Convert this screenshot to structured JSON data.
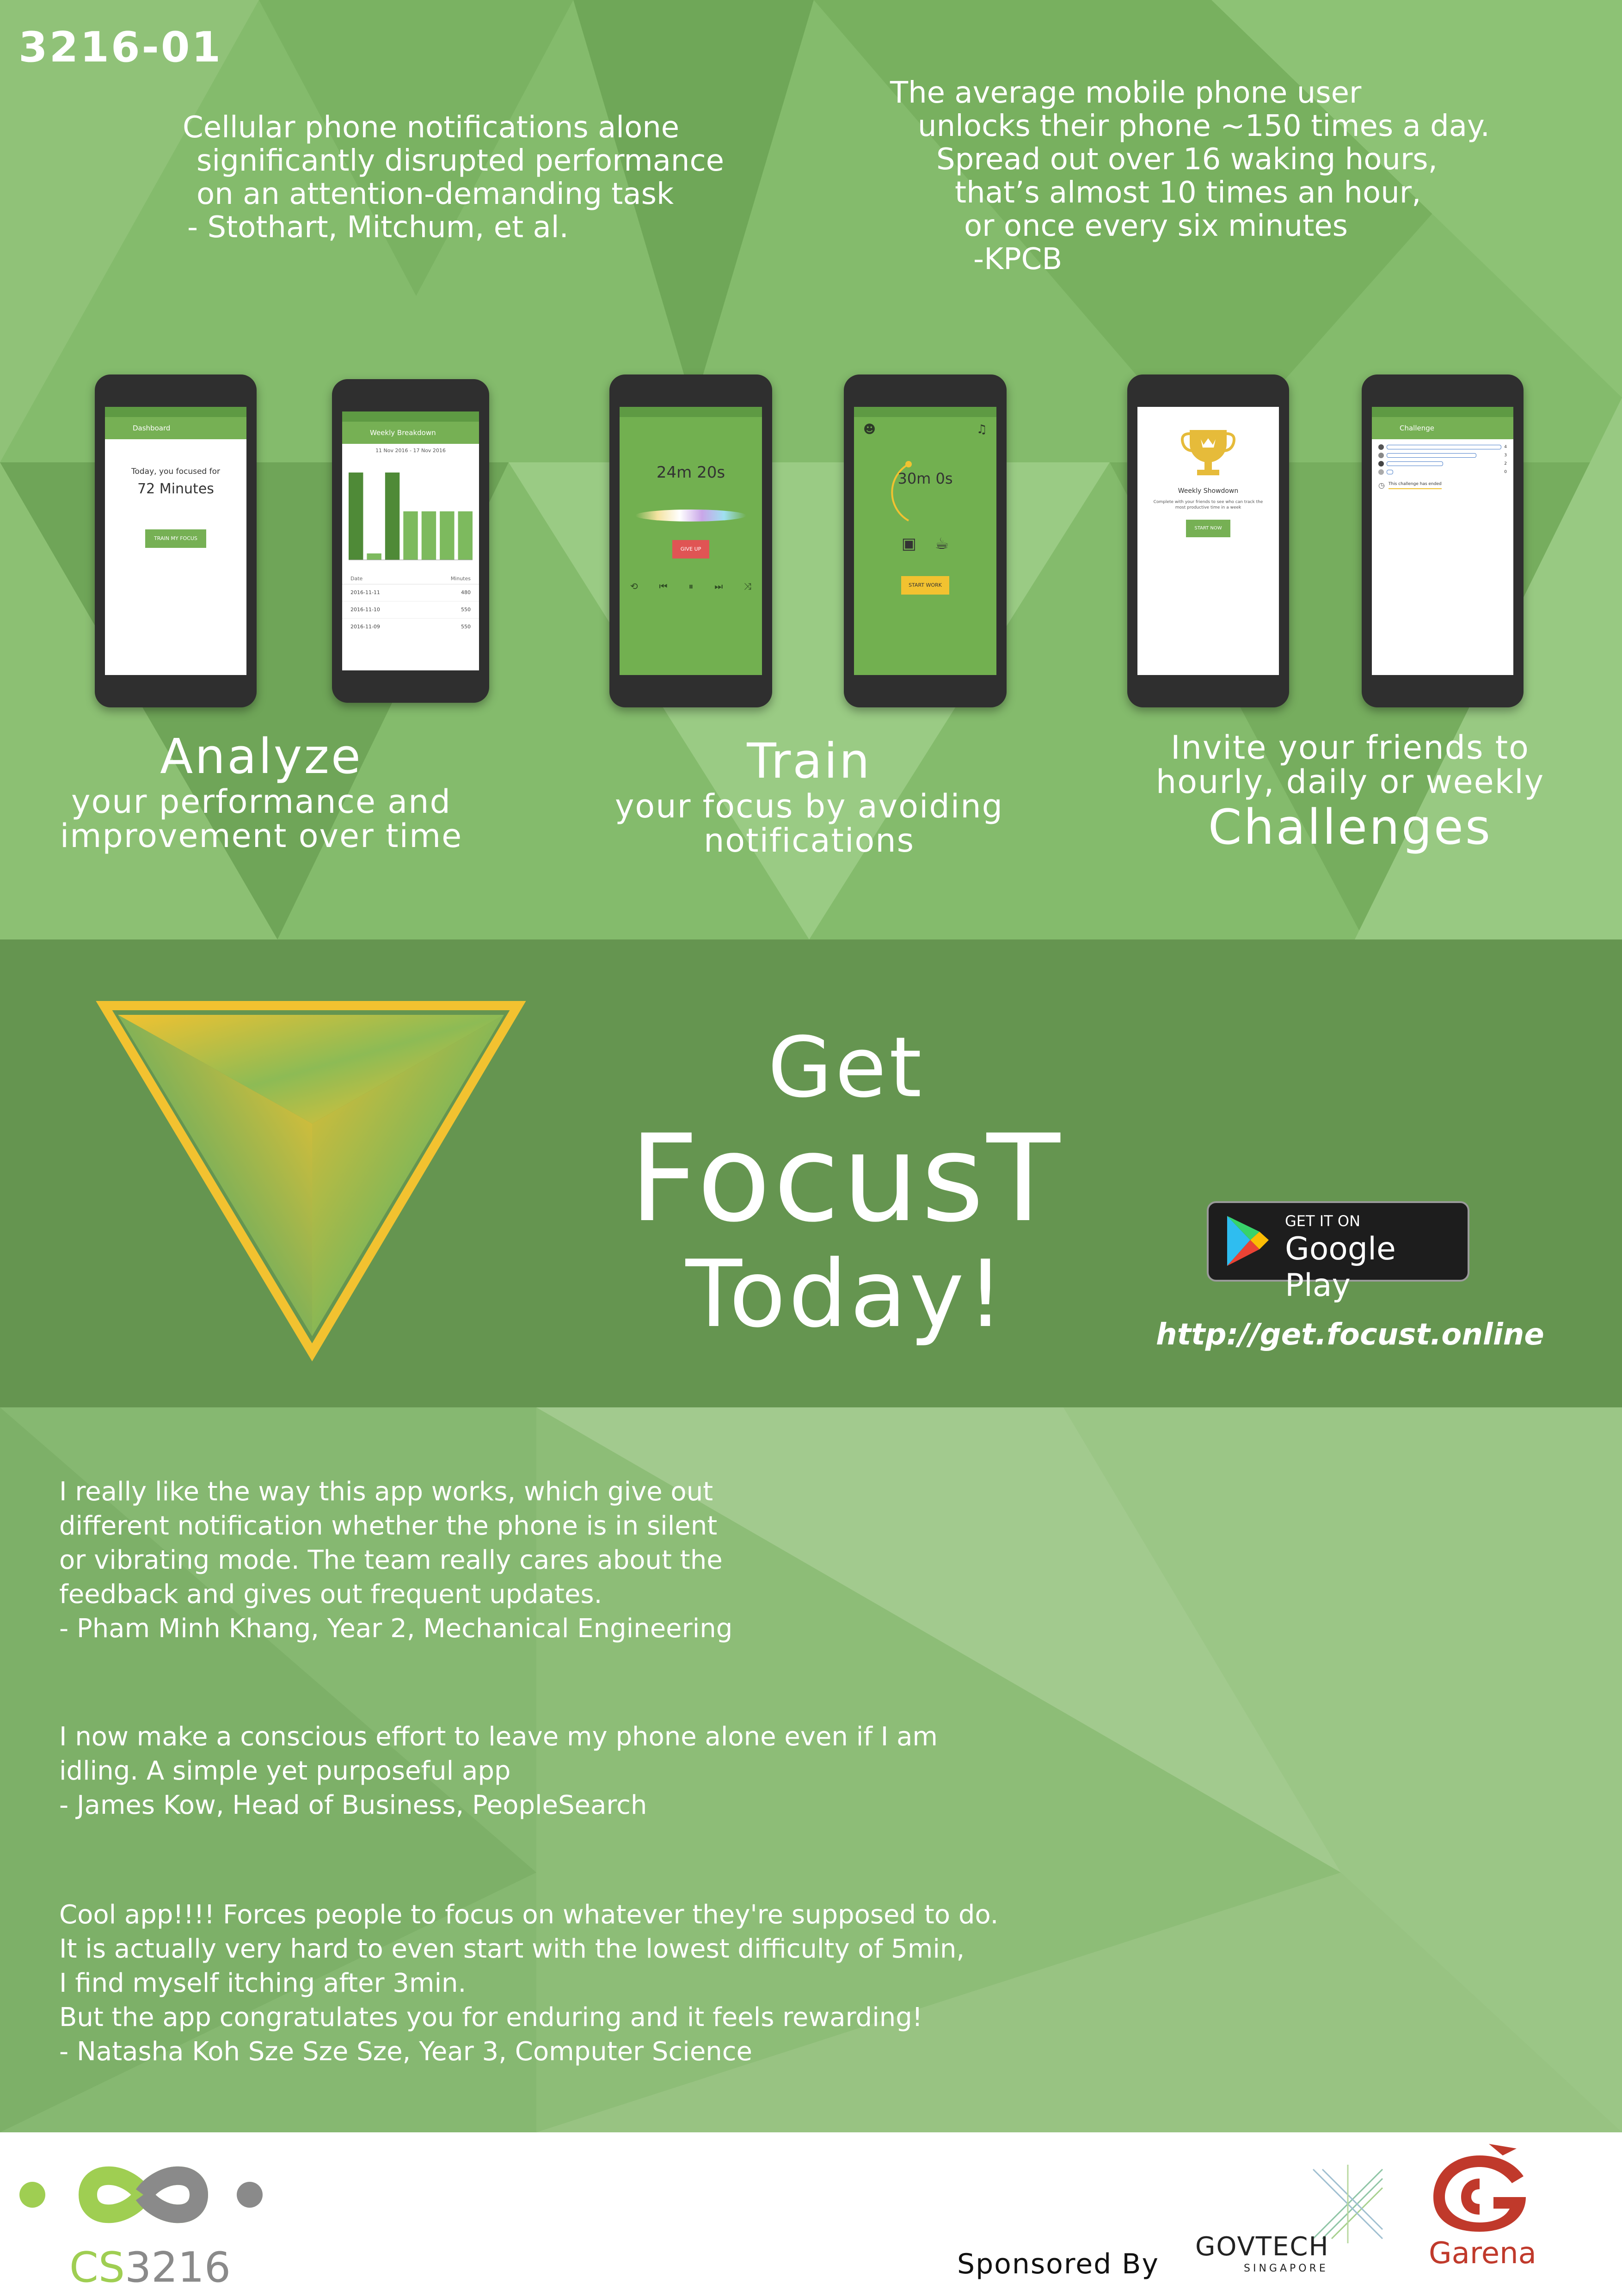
{
  "poster": {
    "id": "3216-01",
    "quote_left": {
      "lines": [
        "Cellular phone notifications alone",
        "significantly disrupted performance",
        "on an attention-demanding task",
        "- Stothart, Mitchum, et al."
      ]
    },
    "quote_right": {
      "lines": [
        "The average mobile phone user",
        "unlocks their phone ~150 times a day.",
        "Spread out over 16 waking hours,",
        "that’s almost 10 times an hour,",
        "or once every six minutes",
        "-KPCB"
      ]
    }
  },
  "phones": {
    "dashboard": {
      "title": "Dashboard",
      "focused_text": "Today, you focused for",
      "minutes": "72 Minutes",
      "button": "TRAIN MY FOCUS"
    },
    "weekly": {
      "title": "Weekly Breakdown",
      "range": "11 Nov 2016 - 17 Nov 2016",
      "bar_values": [
        540,
        40,
        540,
        300,
        300,
        300,
        300
      ],
      "bar_max": 600,
      "table_header": [
        "Date",
        "Minutes"
      ],
      "rows": [
        [
          "2016-11-11",
          "480"
        ],
        [
          "2016-11-10",
          "550"
        ],
        [
          "2016-11-09",
          "550"
        ]
      ]
    },
    "session": {
      "timer": "24m 20s",
      "button": "GIVE UP"
    },
    "setup": {
      "timer": "30m 0s",
      "button": "START WORK"
    },
    "showdown": {
      "title": "Weekly Showdown",
      "desc": "Complete with your friends to see who can track the most productive time in a week",
      "button": "START NOW"
    },
    "challenge": {
      "title": "Challenge",
      "ended": "This challenge has ended",
      "scores": [
        4,
        3,
        2,
        0
      ]
    }
  },
  "features": {
    "analyze": {
      "title": "Analyze",
      "sub": [
        "your performance and",
        "improvement over time"
      ]
    },
    "train": {
      "title": "Train",
      "sub": [
        "your focus by avoiding",
        "notifications"
      ]
    },
    "challenges": {
      "pre": [
        "Invite your friends to",
        "hourly, daily or weekly"
      ],
      "title": "Challenges"
    }
  },
  "cta": {
    "line1": "Get",
    "line2": "FocusT",
    "line3": "Today!",
    "google_small": "GET IT ON",
    "google_big": "Google Play",
    "url": "http://get.focust.online"
  },
  "testimonials": [
    {
      "lines": [
        "I really like the way this app works, which give out",
        "different notification whether the phone is in silent",
        "or vibrating mode. The team really cares about the",
        "feedback and gives out frequent updates.",
        "- Pham Minh Khang, Year 2, Mechanical Engineering"
      ]
    },
    {
      "lines": [
        "I now make a conscious effort to leave my phone alone even if I am",
        "idling. A simple yet purposeful app",
        "- James Kow, Head of Business, PeopleSearch"
      ]
    },
    {
      "lines": [
        "Cool app!!!! Forces people to focus on whatever they're supposed to do.",
        "It is actually very hard to even start with the lowest difficulty of 5min,",
        "I find myself itching after 3min.",
        "But the app congratulates you for enduring and it feels rewarding!",
        "-  Natasha Koh Sze Sze Sze, Year 3, Computer Science"
      ]
    }
  ],
  "footer": {
    "course": "CS3216",
    "course_prefix": "CS",
    "course_number": "3216",
    "sponsored": "Sponsored By",
    "govtech": "GOVTECH",
    "govtech_sub": "SINGAPORE",
    "garena": "Garena"
  },
  "colors": {
    "accent_yellow": "#f2c230",
    "band_green": "#659550",
    "garena_red": "#c0392b"
  }
}
